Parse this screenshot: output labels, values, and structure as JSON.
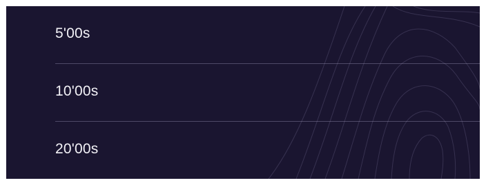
{
  "duration_list": {
    "options": [
      {
        "label": "5'00s"
      },
      {
        "label": "10'00s"
      },
      {
        "label": "20'00s"
      }
    ]
  },
  "theme": {
    "background": "#1a1530",
    "text": "#f2f1f6",
    "divider": "#b4afcd",
    "contour_lines": "#5a5478"
  }
}
